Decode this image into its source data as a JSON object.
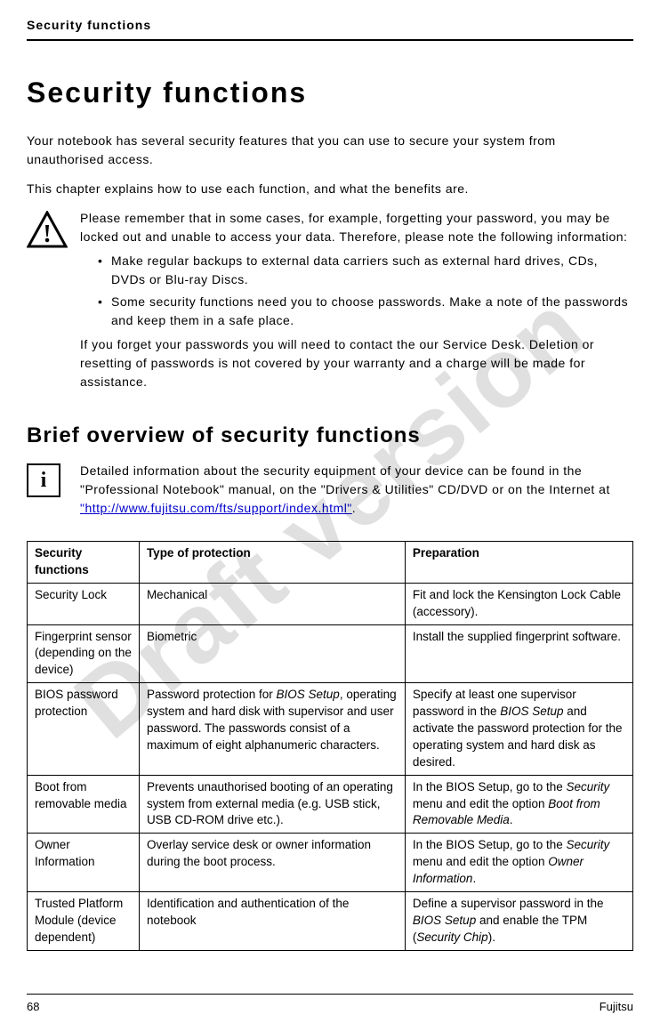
{
  "watermark": "Draft version",
  "header": {
    "title": "Security functions"
  },
  "main_title": "Security functions",
  "intro_p1": "Your notebook has several security features that you can use to secure your system from unauthorised access.",
  "intro_p2": "This chapter explains how to use each function, and what the benefits are.",
  "warning": {
    "p1": "Please remember that in some cases, for example, forgetting your password, you may be locked out and unable to access your data. Therefore, please note the following information:",
    "bullet1": "Make regular backups to external data carriers such as external hard drives, CDs, DVDs or Blu-ray Discs.",
    "bullet2": "Some security functions need you to choose passwords. Make a note of the passwords and keep them in a safe place.",
    "p2": "If you forget your passwords you will need to contact the our Service Desk. Deletion or resetting of passwords is not covered by your warranty and a charge will be made for assistance."
  },
  "section2_title": "Brief overview of security functions",
  "info": {
    "text_before": "Detailed information about the security equipment of your device can be found in the \"Professional Notebook\" manual, on the \"Drivers & Utilities\" CD/DVD or on the Internet at ",
    "link_text": "\"http://www.fujitsu.com/fts/support/index.html\"",
    "text_after": "."
  },
  "table": {
    "headers": {
      "col1": "Security functions",
      "col2": "Type of protection",
      "col3": "Preparation"
    },
    "rows": [
      {
        "c1": "Security Lock",
        "c2": "Mechanical",
        "c3": "Fit and lock the Kensington Lock Cable (accessory)."
      },
      {
        "c1": "Fingerprint sensor (depending on the device)",
        "c2": "Biometric",
        "c3": "Install the supplied fingerprint software."
      },
      {
        "c1": "BIOS password protection",
        "c2_html": "Password protection for <span class=\"italic\">BIOS Setup</span>, operating system and hard disk with supervisor and user password. The passwords consist of a maximum of eight alphanumeric characters.",
        "c3_html": "Specify at least one supervisor password in the <span class=\"italic\">BIOS Setup</span> and activate the password protection for the operating system and hard disk as desired."
      },
      {
        "c1": "Boot from removable media",
        "c2": "Prevents unauthorised booting of an operating system from external media (e.g. USB stick, USB CD-ROM drive etc.).",
        "c3_html": "In the BIOS Setup, go to the <span class=\"italic\">Security</span> menu and edit the option <span class=\"italic\">Boot from Removable Media</span>."
      },
      {
        "c1": "Owner Information",
        "c2": "Overlay service desk or owner information during the boot process.",
        "c3_html": "In the BIOS Setup, go to the <span class=\"italic\">Security</span> menu and edit the option <span class=\"italic\">Owner Information</span>."
      },
      {
        "c1": "Trusted Platform Module (device dependent)",
        "c2": "Identification and authentication of the notebook",
        "c3_html": "Define a supervisor password in the <span class=\"italic\">BIOS Setup</span> and enable the TPM (<span class=\"italic\">Security Chip</span>)."
      }
    ]
  },
  "footer": {
    "page": "68",
    "brand": "Fujitsu"
  }
}
